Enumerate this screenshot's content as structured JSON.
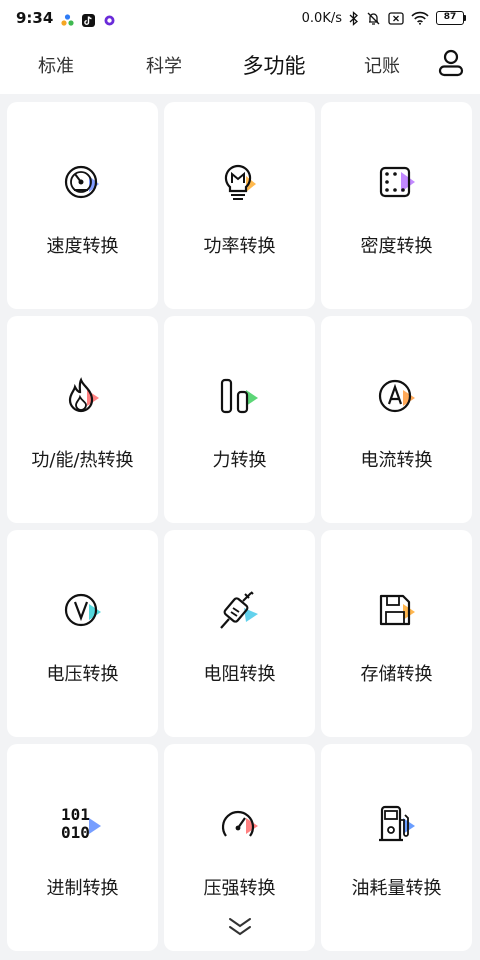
{
  "status_bar": {
    "time": "9:34",
    "net_speed": "0.0K/s",
    "battery": "87"
  },
  "tabs": [
    {
      "label": "标准",
      "active": false
    },
    {
      "label": "科学",
      "active": false
    },
    {
      "label": "多功能",
      "active": true
    },
    {
      "label": "记账",
      "active": false
    }
  ],
  "cards": [
    {
      "label": "速度转换",
      "icon": "speedometer-icon",
      "accent": "#6c8cff"
    },
    {
      "label": "功率转换",
      "icon": "lightbulb-icon",
      "accent": "#ffb13b"
    },
    {
      "label": "密度转换",
      "icon": "density-grid-icon",
      "accent": "#b36bff"
    },
    {
      "label": "功/能/热转换",
      "icon": "flame-icon",
      "accent": "#ff6b6b"
    },
    {
      "label": "力转换",
      "icon": "force-bars-icon",
      "accent": "#3fcf5f"
    },
    {
      "label": "电流转换",
      "icon": "ampere-icon",
      "accent": "#ff9a3c"
    },
    {
      "label": "电压转换",
      "icon": "voltage-icon",
      "accent": "#35d0d6"
    },
    {
      "label": "电阻转换",
      "icon": "plug-icon",
      "accent": "#3cc7e8"
    },
    {
      "label": "存储转换",
      "icon": "floppy-disk-icon",
      "accent": "#ffae3b"
    },
    {
      "label": "进制转换",
      "icon": "binary-icon",
      "accent": "#5f8dff",
      "bin_top": "101",
      "bin_bottom": "010"
    },
    {
      "label": "压强转换",
      "icon": "pressure-gauge-icon",
      "accent": "#ff6b6b"
    },
    {
      "label": "油耗量转换",
      "icon": "fuel-pump-icon",
      "accent": "#4f8cff"
    }
  ]
}
